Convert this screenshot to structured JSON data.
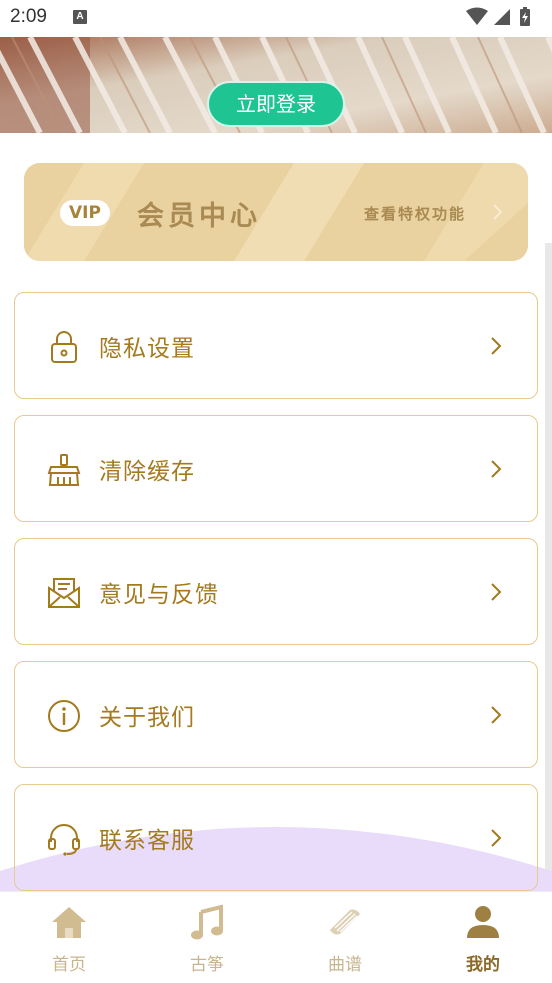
{
  "status_bar": {
    "time": "2:09",
    "notification_letter": "A"
  },
  "header": {
    "login_button": "立即登录"
  },
  "vip": {
    "badge": "VIP",
    "title": "会员中心",
    "subtitle": "查看特权功能"
  },
  "menu": [
    {
      "label": "隐私设置",
      "icon": "lock-icon"
    },
    {
      "label": "清除缓存",
      "icon": "broom-icon"
    },
    {
      "label": "意见与反馈",
      "icon": "mail-icon"
    },
    {
      "label": "关于我们",
      "icon": "info-icon"
    },
    {
      "label": "联系客服",
      "icon": "headset-icon"
    }
  ],
  "bottom_nav": [
    {
      "label": "首页",
      "icon": "home-icon",
      "active": false
    },
    {
      "label": "古筝",
      "icon": "music-note-icon",
      "active": false
    },
    {
      "label": "曲谱",
      "icon": "guzheng-icon",
      "active": false
    },
    {
      "label": "我的",
      "icon": "user-icon",
      "active": true
    }
  ],
  "colors": {
    "accent_gold": "#a47a1e",
    "card_border": "#e8c98e",
    "login_green": "#1fc493",
    "vip_bg": "#ead2a0",
    "nav_inactive": "#c8b48f",
    "nav_active": "#8a6a2a",
    "wave_lavender": "#e9dcfb"
  }
}
